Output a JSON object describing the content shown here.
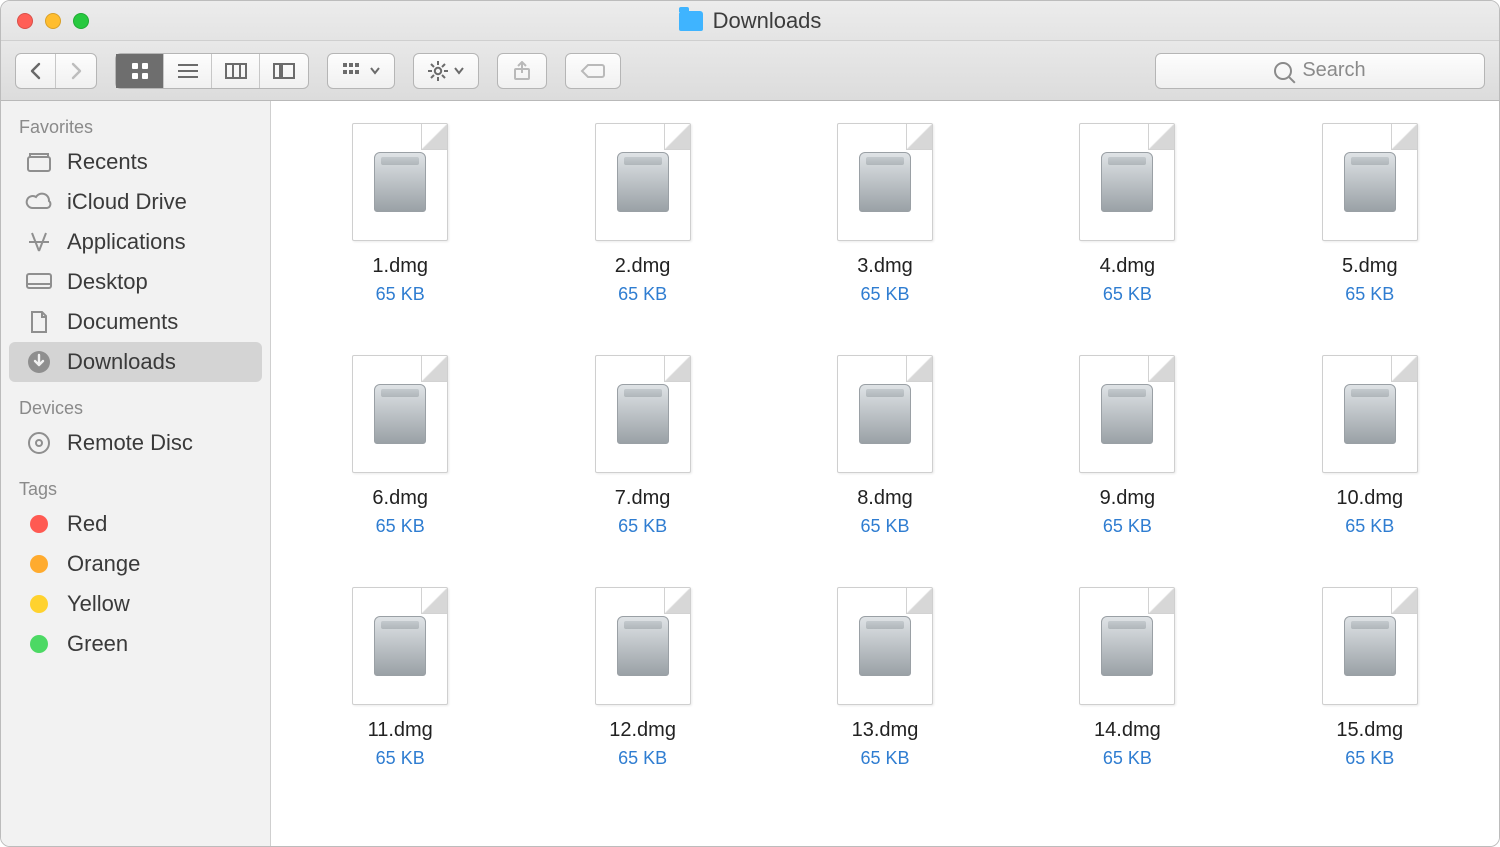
{
  "window": {
    "title": "Downloads"
  },
  "toolbar": {
    "search_placeholder": "Search"
  },
  "sidebar": {
    "sections": {
      "favorites": {
        "label": "Favorites"
      },
      "devices": {
        "label": "Devices"
      },
      "tags": {
        "label": "Tags"
      }
    },
    "favorites": [
      {
        "label": "Recents",
        "icon": "recents"
      },
      {
        "label": "iCloud Drive",
        "icon": "cloud"
      },
      {
        "label": "Applications",
        "icon": "apps"
      },
      {
        "label": "Desktop",
        "icon": "desktop"
      },
      {
        "label": "Documents",
        "icon": "documents"
      },
      {
        "label": "Downloads",
        "icon": "downloads",
        "selected": true
      }
    ],
    "devices": [
      {
        "label": "Remote Disc",
        "icon": "disc"
      }
    ],
    "tags": [
      {
        "label": "Red",
        "color": "#ff5a52"
      },
      {
        "label": "Orange",
        "color": "#ffab2e"
      },
      {
        "label": "Yellow",
        "color": "#ffd22e"
      },
      {
        "label": "Green",
        "color": "#4cd964"
      }
    ]
  },
  "files": [
    {
      "name": "1.dmg",
      "size": "65 KB"
    },
    {
      "name": "2.dmg",
      "size": "65 KB"
    },
    {
      "name": "3.dmg",
      "size": "65 KB"
    },
    {
      "name": "4.dmg",
      "size": "65 KB"
    },
    {
      "name": "5.dmg",
      "size": "65 KB"
    },
    {
      "name": "6.dmg",
      "size": "65 KB"
    },
    {
      "name": "7.dmg",
      "size": "65 KB"
    },
    {
      "name": "8.dmg",
      "size": "65 KB"
    },
    {
      "name": "9.dmg",
      "size": "65 KB"
    },
    {
      "name": "10.dmg",
      "size": "65 KB"
    },
    {
      "name": "11.dmg",
      "size": "65 KB"
    },
    {
      "name": "12.dmg",
      "size": "65 KB"
    },
    {
      "name": "13.dmg",
      "size": "65 KB"
    },
    {
      "name": "14.dmg",
      "size": "65 KB"
    },
    {
      "name": "15.dmg",
      "size": "65 KB"
    }
  ]
}
